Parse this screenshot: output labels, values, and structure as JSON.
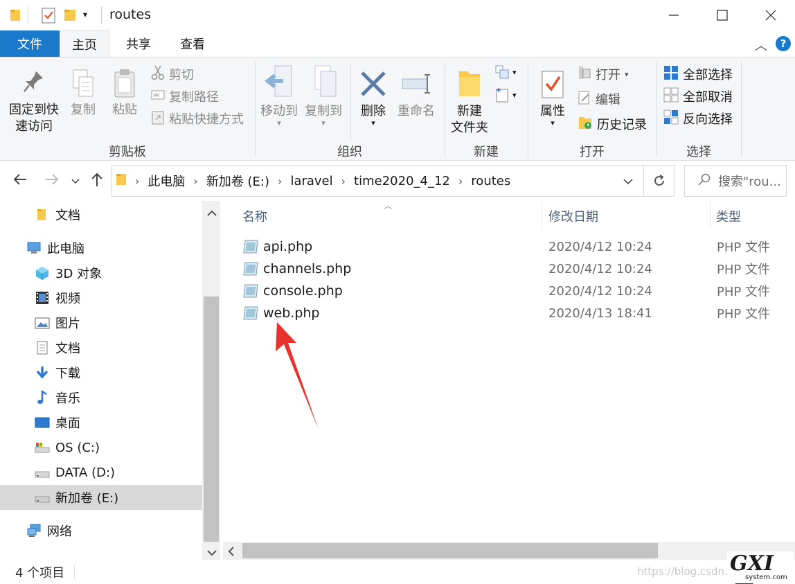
{
  "window": {
    "title": "routes",
    "buttons": {
      "minimize": "minimize-icon",
      "maximize": "maximize-icon",
      "close": "close-icon"
    }
  },
  "tabs": [
    {
      "label": "文件"
    },
    {
      "label": "主页"
    },
    {
      "label": "共享"
    },
    {
      "label": "查看"
    }
  ],
  "ribbon": {
    "clipboard": {
      "pin_line1": "固定到快",
      "pin_line2": "速访问",
      "copy": "复制",
      "paste": "粘贴",
      "cut": "剪切",
      "copy_path": "复制路径",
      "paste_shortcut": "粘贴快捷方式",
      "label": "剪贴板"
    },
    "organize": {
      "move_to": "移动到",
      "copy_to": "复制到",
      "delete": "删除",
      "rename": "重命名",
      "label": "组织"
    },
    "new": {
      "new_folder_line1": "新建",
      "new_folder_line2": "文件夹",
      "label": "新建"
    },
    "open": {
      "properties": "属性",
      "open": "打开",
      "edit": "编辑",
      "history": "历史记录",
      "label": "打开"
    },
    "select": {
      "select_all": "全部选择",
      "select_none": "全部取消",
      "invert": "反向选择",
      "label": "选择"
    }
  },
  "address": {
    "crumbs": [
      "此电脑",
      "新加卷 (E:)",
      "laravel",
      "time2020_4_12",
      "routes"
    ],
    "search_placeholder": "搜索\"rou..."
  },
  "nav": [
    {
      "label": "文档",
      "icon": "folder-icon"
    },
    {
      "label": "此电脑",
      "icon": "computer-icon"
    },
    {
      "label": "3D 对象",
      "icon": "cube-icon"
    },
    {
      "label": "视频",
      "icon": "video-icon"
    },
    {
      "label": "图片",
      "icon": "picture-icon"
    },
    {
      "label": "文档",
      "icon": "document-icon"
    },
    {
      "label": "下载",
      "icon": "download-icon"
    },
    {
      "label": "音乐",
      "icon": "music-icon"
    },
    {
      "label": "桌面",
      "icon": "desktop-icon"
    },
    {
      "label": "OS (C:)",
      "icon": "drive-icon"
    },
    {
      "label": "DATA (D:)",
      "icon": "drive-icon"
    },
    {
      "label": "新加卷 (E:)",
      "icon": "drive-icon"
    },
    {
      "label": "网络",
      "icon": "network-icon"
    }
  ],
  "columns": {
    "name": "名称",
    "date": "修改日期",
    "type": "类型"
  },
  "files": [
    {
      "name": "api.php",
      "date": "2020/4/12 10:24",
      "type": "PHP 文件"
    },
    {
      "name": "channels.php",
      "date": "2020/4/12 10:24",
      "type": "PHP 文件"
    },
    {
      "name": "console.php",
      "date": "2020/4/12 10:24",
      "type": "PHP 文件"
    },
    {
      "name": "web.php",
      "date": "2020/4/13 18:41",
      "type": "PHP 文件"
    }
  ],
  "status": {
    "count": "4 个项目"
  },
  "watermark": {
    "url": "https://blog.csdn.n",
    "logo_text": "GXI网",
    "logo_sub": "system.com"
  },
  "colors": {
    "accent": "#1979ca",
    "annotation": "#e8322c",
    "selection": "#d9d9d9"
  }
}
